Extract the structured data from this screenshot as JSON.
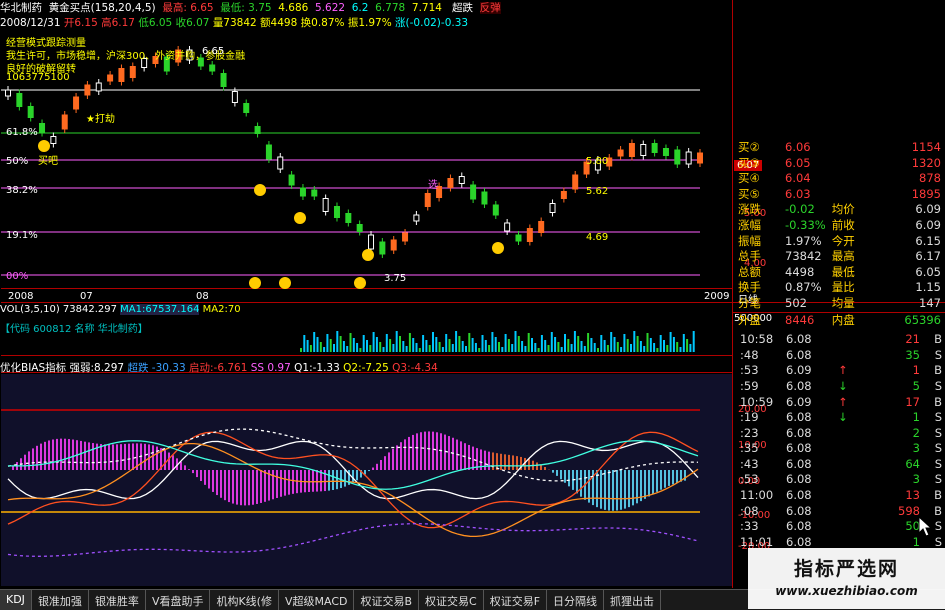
{
  "header": {
    "stock_name": "华北制药",
    "indicator": "黄金买点(158,20,4,5)",
    "fields": [
      "最高: 6.65",
      "最低: 3.75",
      "4.686",
      "5.622",
      "6.2",
      "6.778",
      "7.714"
    ],
    "badge_super": "超跌",
    "badge_anti": "反弹"
  },
  "info": {
    "date": "2008/12/31",
    "open": "开6.15",
    "high": "高6.17",
    "low": "低6.05",
    "close": "收6.07",
    "volume": "量73842",
    "amount": "额4498",
    "change": "换0.87%",
    "amplitude": "振1.97%",
    "rise": "涨(-0.02)-0.33"
  },
  "overlay_text": {
    "line1": "经营模式跟踪测量",
    "line2": "我生许可，市场稳增，沪深300、外资并购，参股金融",
    "line3": "良好的破解留转",
    "line4": "1063775100",
    "buy_label": "★打劫",
    "sell_label": "买吧",
    "select_label": "选",
    "stock_label_right": "5.80",
    "stock_label_right2": "5.62",
    "low_label": "3.75",
    "mid_label": "4.69",
    "top_label": "6.65"
  },
  "fib_levels": [
    "61.8%",
    "50%",
    "38.2%",
    "19.1%",
    "00%"
  ],
  "price_axis": [
    "6.07",
    "5.00",
    "4.00"
  ],
  "time_axis": [
    "2008",
    "07",
    "08",
    "2009",
    "日线"
  ],
  "volume": {
    "label": "VOL(3,5,10)",
    "vol": "73842.297",
    "ma1": "MA1:67537.164",
    "ma2": "MA2:70",
    "axis": "500000",
    "code": "【代码 600812 名称 华北制药】"
  },
  "bias": {
    "title": "优化BIAS指标",
    "strength": "强弱:8.297",
    "super": "超跌",
    "val1": "-30.33",
    "start": "启动:-6.761",
    "ss": "SS 0.97",
    "q1": "Q1:-1.33",
    "q2": "Q2:-7.25",
    "q3": "Q3:-4.34",
    "axis": [
      "20.00",
      "10.00",
      "0.00",
      "-10.00",
      "-20.00"
    ]
  },
  "quote": {
    "rows": [
      {
        "k": "买②",
        "v": "6.06",
        "k2": "",
        "v2": "1154",
        "vc": "#ff3a3a"
      },
      {
        "k": "买③",
        "v": "6.05",
        "k2": "",
        "v2": "1320",
        "vc": "#ff3a3a"
      },
      {
        "k": "买④",
        "v": "6.04",
        "k2": "",
        "v2": "878",
        "vc": "#ff3a3a"
      },
      {
        "k": "买⑤",
        "v": "6.03",
        "k2": "",
        "v2": "1895",
        "vc": "#ff3a3a"
      },
      {
        "k": "涨跌",
        "v": "-0.02",
        "k2": "均价",
        "v2": "6.09",
        "vc": "#2bd42b"
      },
      {
        "k": "涨幅",
        "v": "-0.33%",
        "k2": "前收",
        "v2": "6.09",
        "vc": "#2bd42b"
      },
      {
        "k": "振幅",
        "v": "1.97%",
        "k2": "今开",
        "v2": "6.15",
        "vc": "#ddd"
      },
      {
        "k": "总手",
        "v": "73842",
        "k2": "最高",
        "v2": "6.17",
        "vc": "#ddd"
      },
      {
        "k": "总额",
        "v": "4498",
        "k2": "最低",
        "v2": "6.05",
        "vc": "#ddd"
      },
      {
        "k": "换手",
        "v": "0.87%",
        "k2": "量比",
        "v2": "1.15",
        "vc": "#ddd"
      },
      {
        "k": "分笔",
        "v": "502",
        "k2": "均量",
        "v2": "147",
        "vc": "#ddd"
      },
      {
        "k": "外盘",
        "v": "8446",
        "k2": "内盘",
        "v2": "65396",
        "vc": "#ff3a3a"
      }
    ],
    "price_tag": "6.07"
  },
  "trades": [
    {
      "t": "10:58",
      "p": "6.08",
      "a": "",
      "q": "21",
      "s": "B"
    },
    {
      "t": ":48",
      "p": "6.08",
      "a": "",
      "q": "35",
      "s": "S"
    },
    {
      "t": ":53",
      "p": "6.09",
      "a": "↑",
      "q": "1",
      "s": "B"
    },
    {
      "t": ":59",
      "p": "6.08",
      "a": "↓",
      "q": "5",
      "s": "S"
    },
    {
      "t": "10:59",
      "p": "6.09",
      "a": "↑",
      "q": "17",
      "s": "B"
    },
    {
      "t": ":19",
      "p": "6.08",
      "a": "↓",
      "q": "1",
      "s": "S"
    },
    {
      "t": ":23",
      "p": "6.08",
      "a": "",
      "q": "2",
      "s": "S"
    },
    {
      "t": ":35",
      "p": "6.08",
      "a": "",
      "q": "3",
      "s": "S"
    },
    {
      "t": ":43",
      "p": "6.08",
      "a": "",
      "q": "64",
      "s": "S"
    },
    {
      "t": ":53",
      "p": "6.08",
      "a": "",
      "q": "3",
      "s": "S"
    },
    {
      "t": "11:00",
      "p": "6.08",
      "a": "",
      "q": "13",
      "s": "B"
    },
    {
      "t": ":08",
      "p": "6.08",
      "a": "",
      "q": "598",
      "s": "B"
    },
    {
      "t": ":33",
      "p": "6.08",
      "a": "",
      "q": "50",
      "s": "S"
    },
    {
      "t": "11:01",
      "p": "6.08",
      "a": "",
      "q": "1",
      "s": "S"
    }
  ],
  "tabs": [
    "KDJ",
    "银准加强",
    "银准胜率",
    "V看盘助手",
    "机构K线(修",
    "V超级MACD",
    "权证交易B",
    "权证交易C",
    "权证交易F",
    "日分隔线",
    "抓狸出击"
  ],
  "watermark": {
    "title": "指标严选网",
    "url": "www.xuezhibiao.com"
  },
  "colors": {
    "up": "#ff3a3a",
    "down": "#2bd42b",
    "accent": "#ffff00",
    "grid": "#b00000"
  }
}
